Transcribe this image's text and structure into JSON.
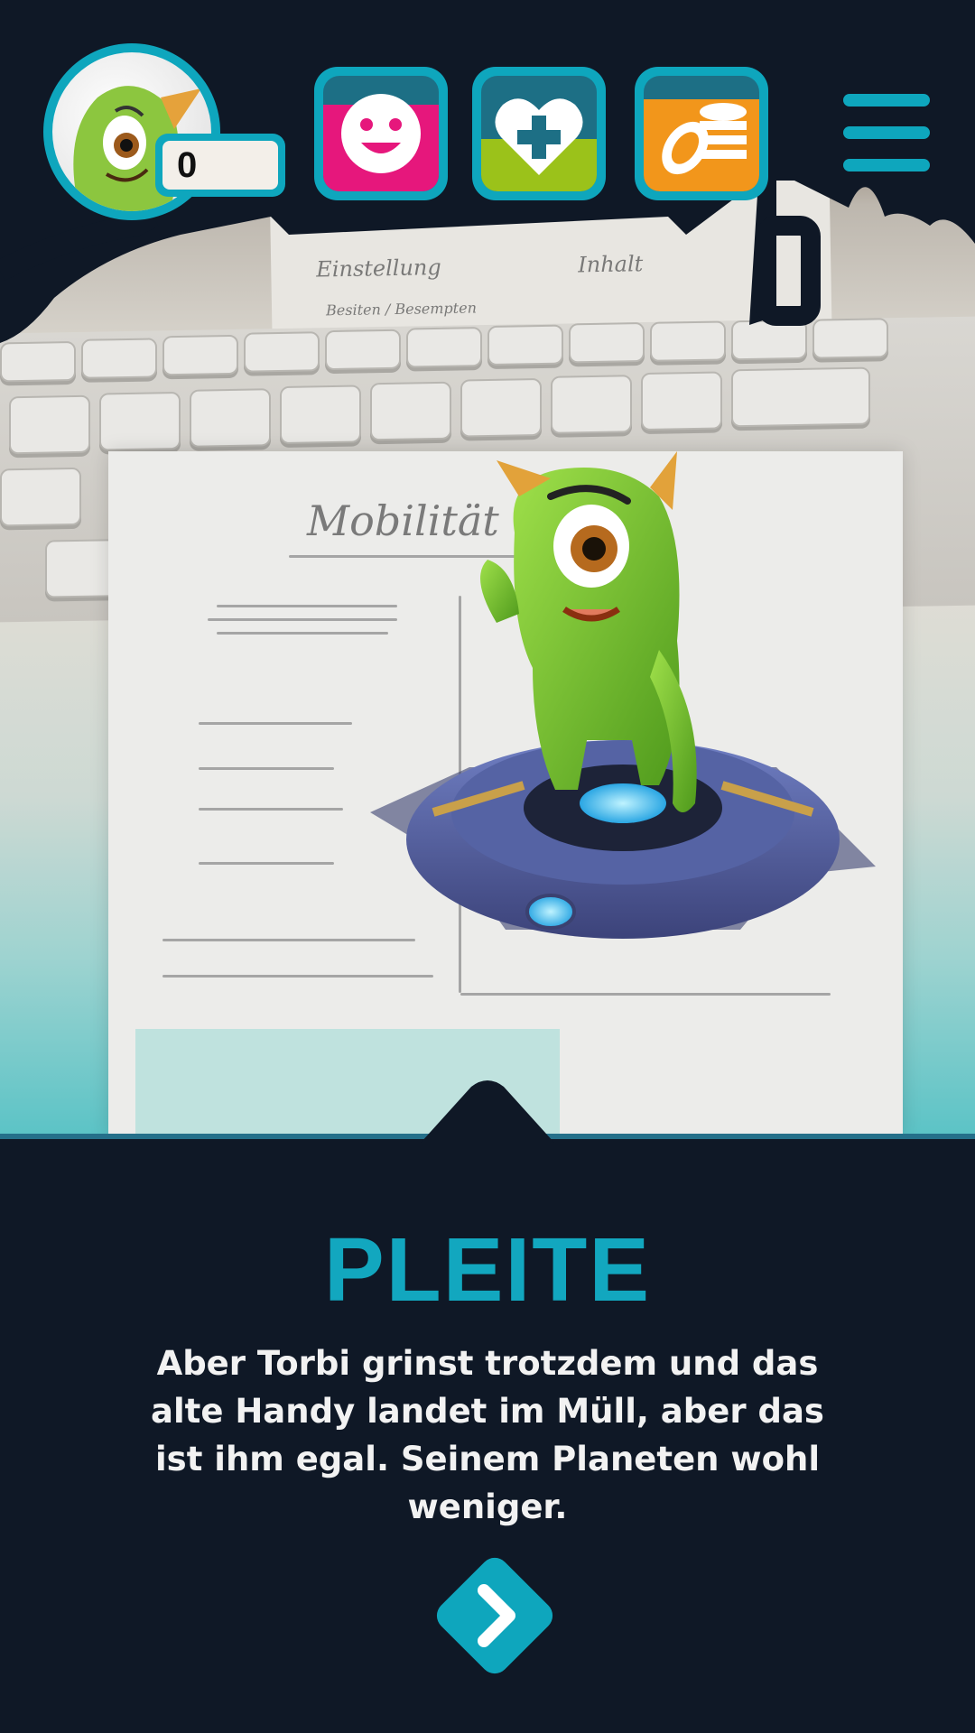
{
  "hud": {
    "score": "0",
    "stats": [
      {
        "name": "mood",
        "icon": "smiley-icon",
        "top": "#1d6f85",
        "bottom": "#e6177c",
        "fill": 0.75
      },
      {
        "name": "health",
        "icon": "heart-plus-icon",
        "top": "#1d6f85",
        "bottom": "#9bc21a",
        "fill": 0.45
      },
      {
        "name": "money",
        "icon": "coins-icon",
        "top": "#1d6f85",
        "bottom": "#f2961b",
        "fill": 0.8
      }
    ],
    "accent": "#0ea6bd"
  },
  "scene": {
    "sketch_words": [
      "Mobilität",
      "Einstellung",
      "Inhalt",
      "Besiten / Besempten"
    ]
  },
  "story": {
    "title": "PLEITE",
    "text": "Aber Torbi grinst trotzdem und das alte Handy landet im Müll, aber das ist ihm egal. Seinem Planeten wohl weniger."
  },
  "colors": {
    "background": "#0f1826",
    "title": "#12a7bf",
    "text": "#f2f2f2"
  }
}
